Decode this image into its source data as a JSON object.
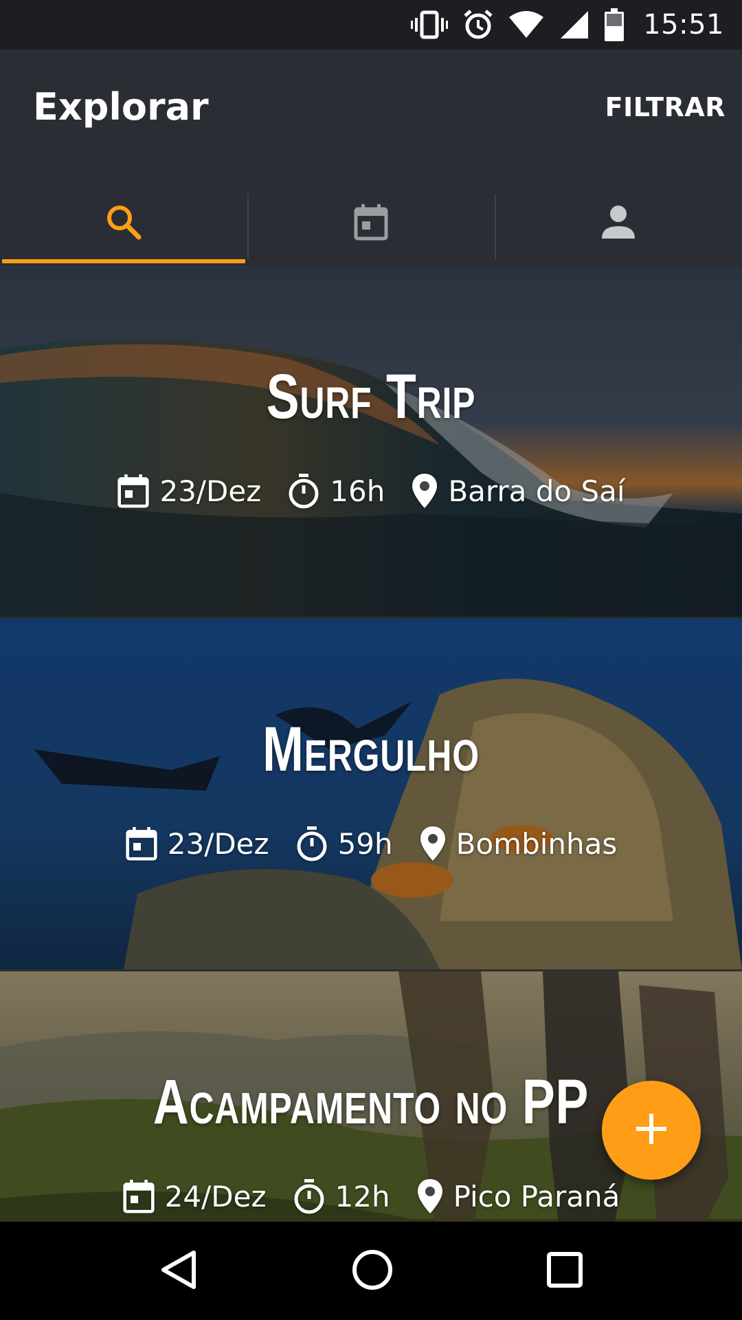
{
  "status_bar": {
    "time": "15:51"
  },
  "app_bar": {
    "title": "Explorar",
    "filter_label": "FILTRAR"
  },
  "tabs": [
    {
      "icon": "search-icon",
      "selected": true
    },
    {
      "icon": "calendar-icon",
      "selected": false
    },
    {
      "icon": "person-icon",
      "selected": false
    }
  ],
  "colors": {
    "accent": "#ff9e16",
    "app_bar": "#2a2d33",
    "status_bar": "#1c1e22"
  },
  "cards": [
    {
      "title": "Surf Trip",
      "date": "23/Dez",
      "duration": "16h",
      "location": "Barra do Saí"
    },
    {
      "title": "Mergulho",
      "date": "23/Dez",
      "duration": "59h",
      "location": "Bombinhas"
    },
    {
      "title": "Acampamento no PP",
      "date": "24/Dez",
      "duration": "12h",
      "location": "Pico Paraná"
    }
  ]
}
